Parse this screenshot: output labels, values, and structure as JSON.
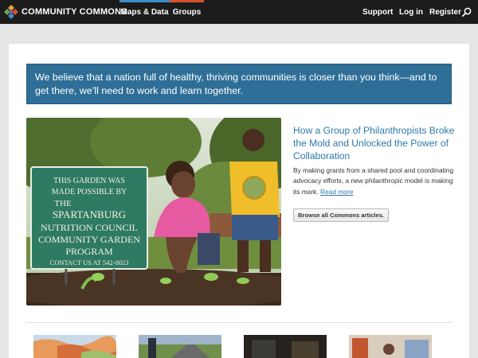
{
  "header": {
    "brand": "COMMUNITY COMMONS",
    "tabs": [
      {
        "label": "Maps & Data",
        "accent": "#3b8fc9"
      },
      {
        "label": "Groups",
        "accent": "#d6532b"
      }
    ],
    "right_links": {
      "support": "Support",
      "login": "Log in",
      "register": "Register"
    },
    "icons": {
      "logo": "community-commons-logo",
      "search": "search-icon"
    }
  },
  "banner": {
    "text": "We believe that a nation full of healthy, thriving communities is closer than you think—and to get there, we’ll need to work and learn together."
  },
  "feature": {
    "image": {
      "sign_lines": [
        "THIS GARDEN WAS",
        "MADE POSSIBLE BY",
        "THE",
        "SPARTANBURG",
        "NUTRITION COUNCIL",
        "COMMUNITY GARDEN",
        "PROGRAM",
        "CONTACT US AT 542-0023"
      ]
    },
    "title": "How a Group of Philanthropists Broke the Mold and Unlocked the Power of Collaboration",
    "body": "By making grants from a shared pool and coordinating advocacy efforts, a new philanthropic model is making its mark.",
    "read_more": "Read more",
    "browse_button": "Browse all Commons articles."
  },
  "colors": {
    "topbar": "#1c1c1c",
    "banner": "#2f6f97",
    "link": "#2f79a8",
    "page_bg": "#e6e6e6"
  }
}
